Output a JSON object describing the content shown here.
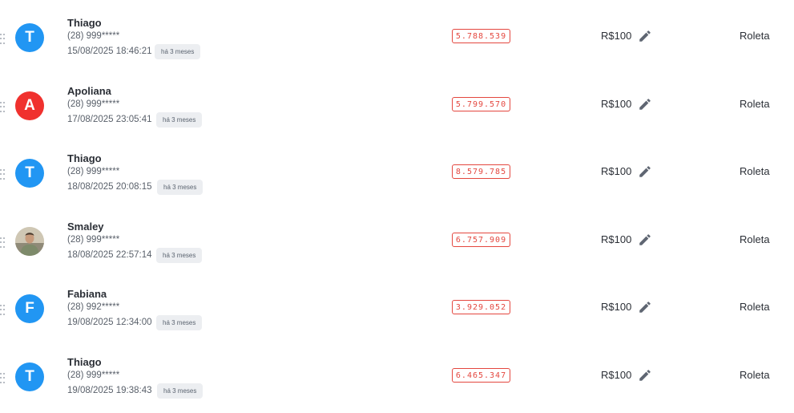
{
  "colors": {
    "blue_avatar": "#2196f3",
    "red_avatar": "#f0312e",
    "ticket_red": "#e4473f"
  },
  "rows": [
    {
      "initial": "T",
      "avatar_color": "#2196f3",
      "avatar_type": "letter",
      "name": "Thiago",
      "phone": "(28) 999*****",
      "datetime": "15/08/2025 18:46:21",
      "ago": "há 3 meses",
      "ticket": "5.788.539",
      "value": "R$100",
      "game": "Roleta"
    },
    {
      "initial": "A",
      "avatar_color": "#f0312e",
      "avatar_type": "letter",
      "name": "Apoliana",
      "phone": "(28) 999*****",
      "datetime": "17/08/2025 23:05:41",
      "ago": "há 3 meses",
      "ticket": "5.799.570",
      "value": "R$100",
      "game": "Roleta"
    },
    {
      "initial": "T",
      "avatar_color": "#2196f3",
      "avatar_type": "letter",
      "name": "Thiago",
      "phone": "(28) 999*****",
      "datetime": "18/08/2025 20:08:15",
      "ago": "há 3 meses",
      "ticket": "8.579.785",
      "value": "R$100",
      "game": "Roleta"
    },
    {
      "initial": "",
      "avatar_color": "#7d8a6a",
      "avatar_type": "photo",
      "name": "Smaley",
      "phone": "(28) 999*****",
      "datetime": "18/08/2025 22:57:14",
      "ago": "há 3 meses",
      "ticket": "6.757.909",
      "value": "R$100",
      "game": "Roleta"
    },
    {
      "initial": "F",
      "avatar_color": "#2196f3",
      "avatar_type": "letter",
      "name": "Fabiana",
      "phone": "(28) 992*****",
      "datetime": "19/08/2025 12:34:00",
      "ago": "há 3 meses",
      "ticket": "3.929.052",
      "value": "R$100",
      "game": "Roleta"
    },
    {
      "initial": "T",
      "avatar_color": "#2196f3",
      "avatar_type": "letter",
      "name": "Thiago",
      "phone": "(28) 999*****",
      "datetime": "19/08/2025 19:38:43",
      "ago": "há 3 meses",
      "ticket": "6.465.347",
      "value": "R$100",
      "game": "Roleta"
    }
  ]
}
